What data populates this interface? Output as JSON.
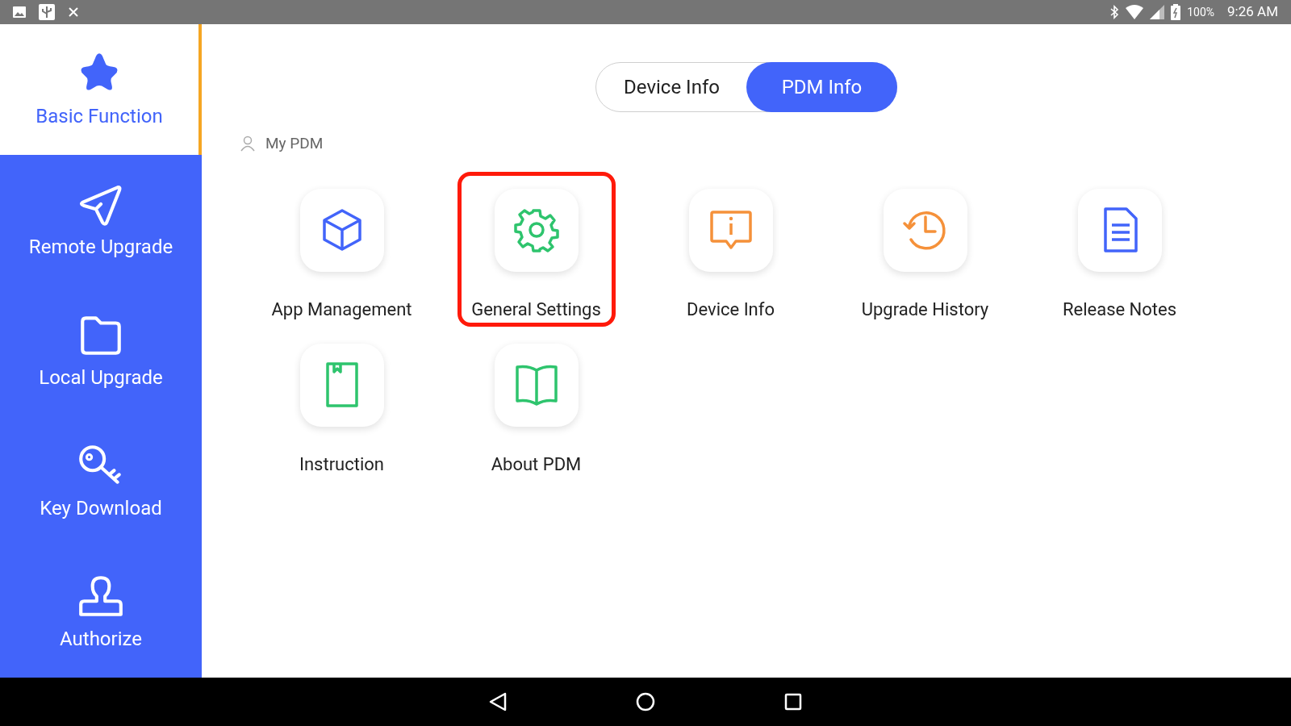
{
  "status_bar": {
    "battery": "100%",
    "time": "9:26 AM"
  },
  "sidebar": {
    "items": [
      {
        "label": "Basic Function",
        "selected": true
      },
      {
        "label": "Remote Upgrade",
        "selected": false
      },
      {
        "label": "Local Upgrade",
        "selected": false
      },
      {
        "label": "Key Download",
        "selected": false
      },
      {
        "label": "Authorize",
        "selected": false
      }
    ]
  },
  "tabs": [
    {
      "label": "Device Info",
      "selected": false
    },
    {
      "label": "PDM Info",
      "selected": true
    }
  ],
  "section": {
    "title": "My PDM"
  },
  "apps": [
    {
      "label": "App Management",
      "highlighted": false
    },
    {
      "label": "General Settings",
      "highlighted": true
    },
    {
      "label": "Device Info",
      "highlighted": false
    },
    {
      "label": "Upgrade History",
      "highlighted": false
    },
    {
      "label": "Release Notes",
      "highlighted": false
    },
    {
      "label": "Instruction",
      "highlighted": false
    },
    {
      "label": "About PDM",
      "highlighted": false
    }
  ]
}
